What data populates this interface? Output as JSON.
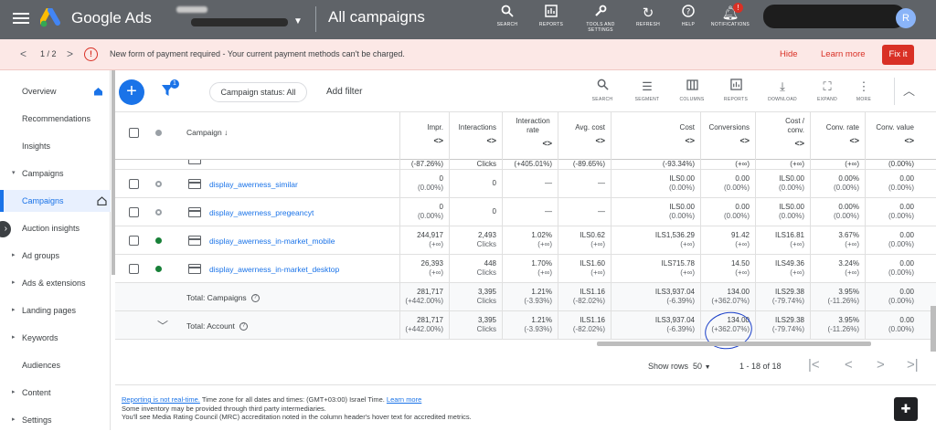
{
  "topbar": {
    "brand": "Google Ads",
    "title": "All campaigns",
    "tools": [
      {
        "icon": "search-icon",
        "label": "SEARCH"
      },
      {
        "icon": "reports-icon",
        "label": "REPORTS"
      },
      {
        "icon": "wrench-icon",
        "label": "TOOLS AND SETTINGS"
      },
      {
        "icon": "refresh-icon",
        "label": "REFRESH"
      },
      {
        "icon": "help-icon",
        "label": "HELP"
      },
      {
        "icon": "bell-icon",
        "label": "NOTIFICATIONS",
        "badge": "!"
      }
    ],
    "avatar_letter": "R"
  },
  "notice": {
    "pager": "1 / 2",
    "message": "New form of payment required - Your current payment methods can't be charged.",
    "hide": "Hide",
    "learn_more": "Learn more",
    "fix": "Fix it"
  },
  "sidebar": {
    "items": [
      {
        "label": "Overview",
        "home": true
      },
      {
        "label": "Recommendations"
      },
      {
        "label": "Insights"
      },
      {
        "label": "Campaigns",
        "caret": "▾"
      },
      {
        "label": "Campaigns",
        "active": true,
        "home": true
      },
      {
        "label": "Auction insights"
      },
      {
        "label": "Ad groups",
        "caret": "▸"
      },
      {
        "label": "Ads & extensions",
        "caret": "▸"
      },
      {
        "label": "Landing pages",
        "caret": "▸"
      },
      {
        "label": "Keywords",
        "caret": "▸"
      },
      {
        "label": "Audiences"
      },
      {
        "label": "Content",
        "caret": "▸"
      },
      {
        "label": "Settings",
        "caret": "▸"
      }
    ]
  },
  "toolbar": {
    "filter_badge": "1",
    "status_chip": "Campaign status: All",
    "add_filter": "Add filter",
    "tools": [
      {
        "icon": "search-icon",
        "label": "SEARCH"
      },
      {
        "icon": "segment-icon",
        "label": "SEGMENT"
      },
      {
        "icon": "columns-icon",
        "label": "COLUMNS"
      },
      {
        "icon": "reports-icon",
        "label": "REPORTS"
      },
      {
        "icon": "download-icon",
        "label": "DOWNLOAD"
      },
      {
        "icon": "expand-icon",
        "label": "EXPAND"
      },
      {
        "icon": "more-icon",
        "label": "MORE"
      }
    ]
  },
  "table": {
    "headers": {
      "campaign": "Campaign ↓",
      "impr": "Impr.",
      "interactions": "Interactions",
      "interaction_rate": "Interaction rate",
      "avg_cost": "Avg. cost",
      "cost": "Cost",
      "conversions": "Conversions",
      "cost_conv": "Cost / conv.",
      "conv_rate": "Conv. rate",
      "conv_value": "Conv. value"
    },
    "sort_glyph": "<>",
    "partial_row": [
      "(-87.26%)",
      "Clicks",
      "(+405.01%)",
      "(-89.65%)",
      "(-93.34%)",
      "(+∞)",
      "(+∞)",
      "(+∞)",
      "(0.00%)"
    ],
    "rows": [
      {
        "status": "paused",
        "name": "display_awerness_similar",
        "impr": [
          "0",
          "(0.00%)"
        ],
        "interactions": [
          "0",
          ""
        ],
        "interaction_rate": [
          "—",
          ""
        ],
        "avg_cost": [
          "—",
          ""
        ],
        "cost": [
          "ILS0.00",
          "(0.00%)"
        ],
        "conversions": [
          "0.00",
          "(0.00%)"
        ],
        "cost_conv": [
          "ILS0.00",
          "(0.00%)"
        ],
        "conv_rate": [
          "0.00%",
          "(0.00%)"
        ],
        "conv_value": [
          "0.00",
          "(0.00%)"
        ]
      },
      {
        "status": "paused",
        "name": "display_awerness_pregeancyt",
        "impr": [
          "0",
          "(0.00%)"
        ],
        "interactions": [
          "0",
          ""
        ],
        "interaction_rate": [
          "—",
          ""
        ],
        "avg_cost": [
          "—",
          ""
        ],
        "cost": [
          "ILS0.00",
          "(0.00%)"
        ],
        "conversions": [
          "0.00",
          "(0.00%)"
        ],
        "cost_conv": [
          "ILS0.00",
          "(0.00%)"
        ],
        "conv_rate": [
          "0.00%",
          "(0.00%)"
        ],
        "conv_value": [
          "0.00",
          "(0.00%)"
        ]
      },
      {
        "status": "enabled",
        "name": "display_awerness_in-market_mobile",
        "impr": [
          "244,917",
          "(+∞)"
        ],
        "interactions": [
          "2,493",
          "Clicks"
        ],
        "interaction_rate": [
          "1.02%",
          "(+∞)"
        ],
        "avg_cost": [
          "ILS0.62",
          "(+∞)"
        ],
        "cost": [
          "ILS1,536.29",
          "(+∞)"
        ],
        "conversions": [
          "91.42",
          "(+∞)"
        ],
        "cost_conv": [
          "ILS16.81",
          "(+∞)"
        ],
        "conv_rate": [
          "3.67%",
          "(+∞)"
        ],
        "conv_value": [
          "0.00",
          "(0.00%)"
        ]
      },
      {
        "status": "enabled",
        "name": "display_awerness_in-market_desktop",
        "impr": [
          "26,393",
          "(+∞)"
        ],
        "interactions": [
          "448",
          "Clicks"
        ],
        "interaction_rate": [
          "1.70%",
          "(+∞)"
        ],
        "avg_cost": [
          "ILS1.60",
          "(+∞)"
        ],
        "cost": [
          "ILS715.78",
          "(+∞)"
        ],
        "conversions": [
          "14.50",
          "(+∞)"
        ],
        "cost_conv": [
          "ILS49.36",
          "(+∞)"
        ],
        "conv_rate": [
          "3.24%",
          "(+∞)"
        ],
        "conv_value": [
          "0.00",
          "(0.00%)"
        ]
      }
    ],
    "totals": [
      {
        "label": "Total: Campaigns",
        "impr": [
          "281,717",
          "(+442.00%)"
        ],
        "interactions": [
          "3,395",
          "Clicks"
        ],
        "interaction_rate": [
          "1.21%",
          "(-3.93%)"
        ],
        "avg_cost": [
          "ILS1.16",
          "(-82.02%)"
        ],
        "cost": [
          "ILS3,937.04",
          "(-6.39%)"
        ],
        "conversions": [
          "134.00",
          "(+362.07%)"
        ],
        "cost_conv": [
          "ILS29.38",
          "(-79.74%)"
        ],
        "conv_rate": [
          "3.95%",
          "(-11.26%)"
        ],
        "conv_value": [
          "0.00",
          "(0.00%)"
        ]
      },
      {
        "label": "Total: Account",
        "impr": [
          "281,717",
          "(+442.00%)"
        ],
        "interactions": [
          "3,395",
          "Clicks"
        ],
        "interaction_rate": [
          "1.21%",
          "(-3.93%)"
        ],
        "avg_cost": [
          "ILS1.16",
          "(-82.02%)"
        ],
        "cost": [
          "ILS3,937.04",
          "(-6.39%)"
        ],
        "conversions": [
          "134.00",
          "(+362.07%)"
        ],
        "cost_conv": [
          "ILS29.38",
          "(-79.74%)"
        ],
        "conv_rate": [
          "3.95%",
          "(-11.26%)"
        ],
        "conv_value": [
          "0.00",
          "(0.00%)"
        ]
      }
    ]
  },
  "pager": {
    "show_rows_label": "Show rows",
    "show_rows_value": "50",
    "range": "1 - 18 of 18"
  },
  "info": {
    "line1_link": "Reporting is not real-time.",
    "line1_text": " Time zone for all dates and times: (GMT+03:00) Israel Time. ",
    "line1_link2": "Learn more",
    "line2": "Some inventory may be provided through third party intermediaries.",
    "line3": "You'll see Media Rating Council (MRC) accreditation noted in the column header's hover text for accredited metrics."
  },
  "colors": {
    "topbar": "#5f6368",
    "accent": "#1a73e8",
    "error": "#d93025",
    "enabled": "#188038",
    "paused": "#9aa0a6"
  }
}
